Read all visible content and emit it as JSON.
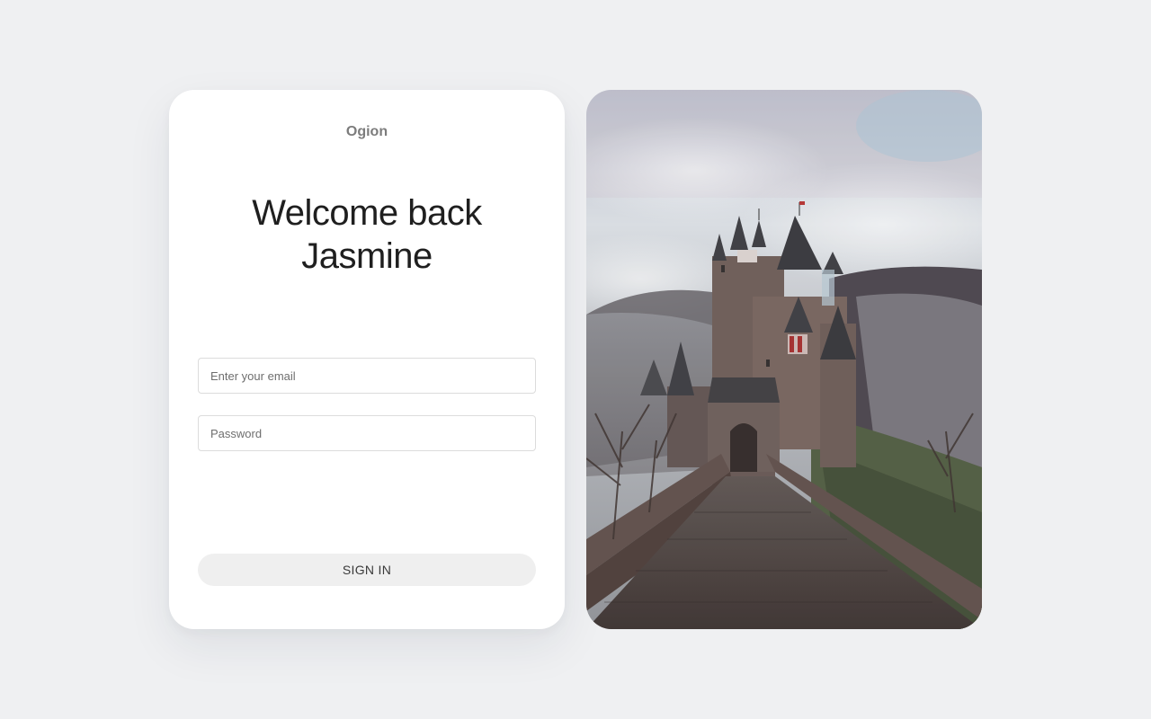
{
  "brand": {
    "name": "Ogion"
  },
  "heading": {
    "line1": "Welcome back",
    "line2": "Jasmine"
  },
  "form": {
    "email_placeholder": "Enter your email",
    "password_placeholder": "Password",
    "submit_label": "SIGN IN"
  },
  "image": {
    "subject": "castle-on-misty-hill",
    "colors": {
      "sky_top": "#b9c3cd",
      "sky_mid": "#d9dde2",
      "hill": "#4f4a4d",
      "stone": "#6b5a55",
      "roof": "#3a3a3f",
      "path": "#4a3f3c",
      "grass": "#4e5a3f"
    }
  }
}
